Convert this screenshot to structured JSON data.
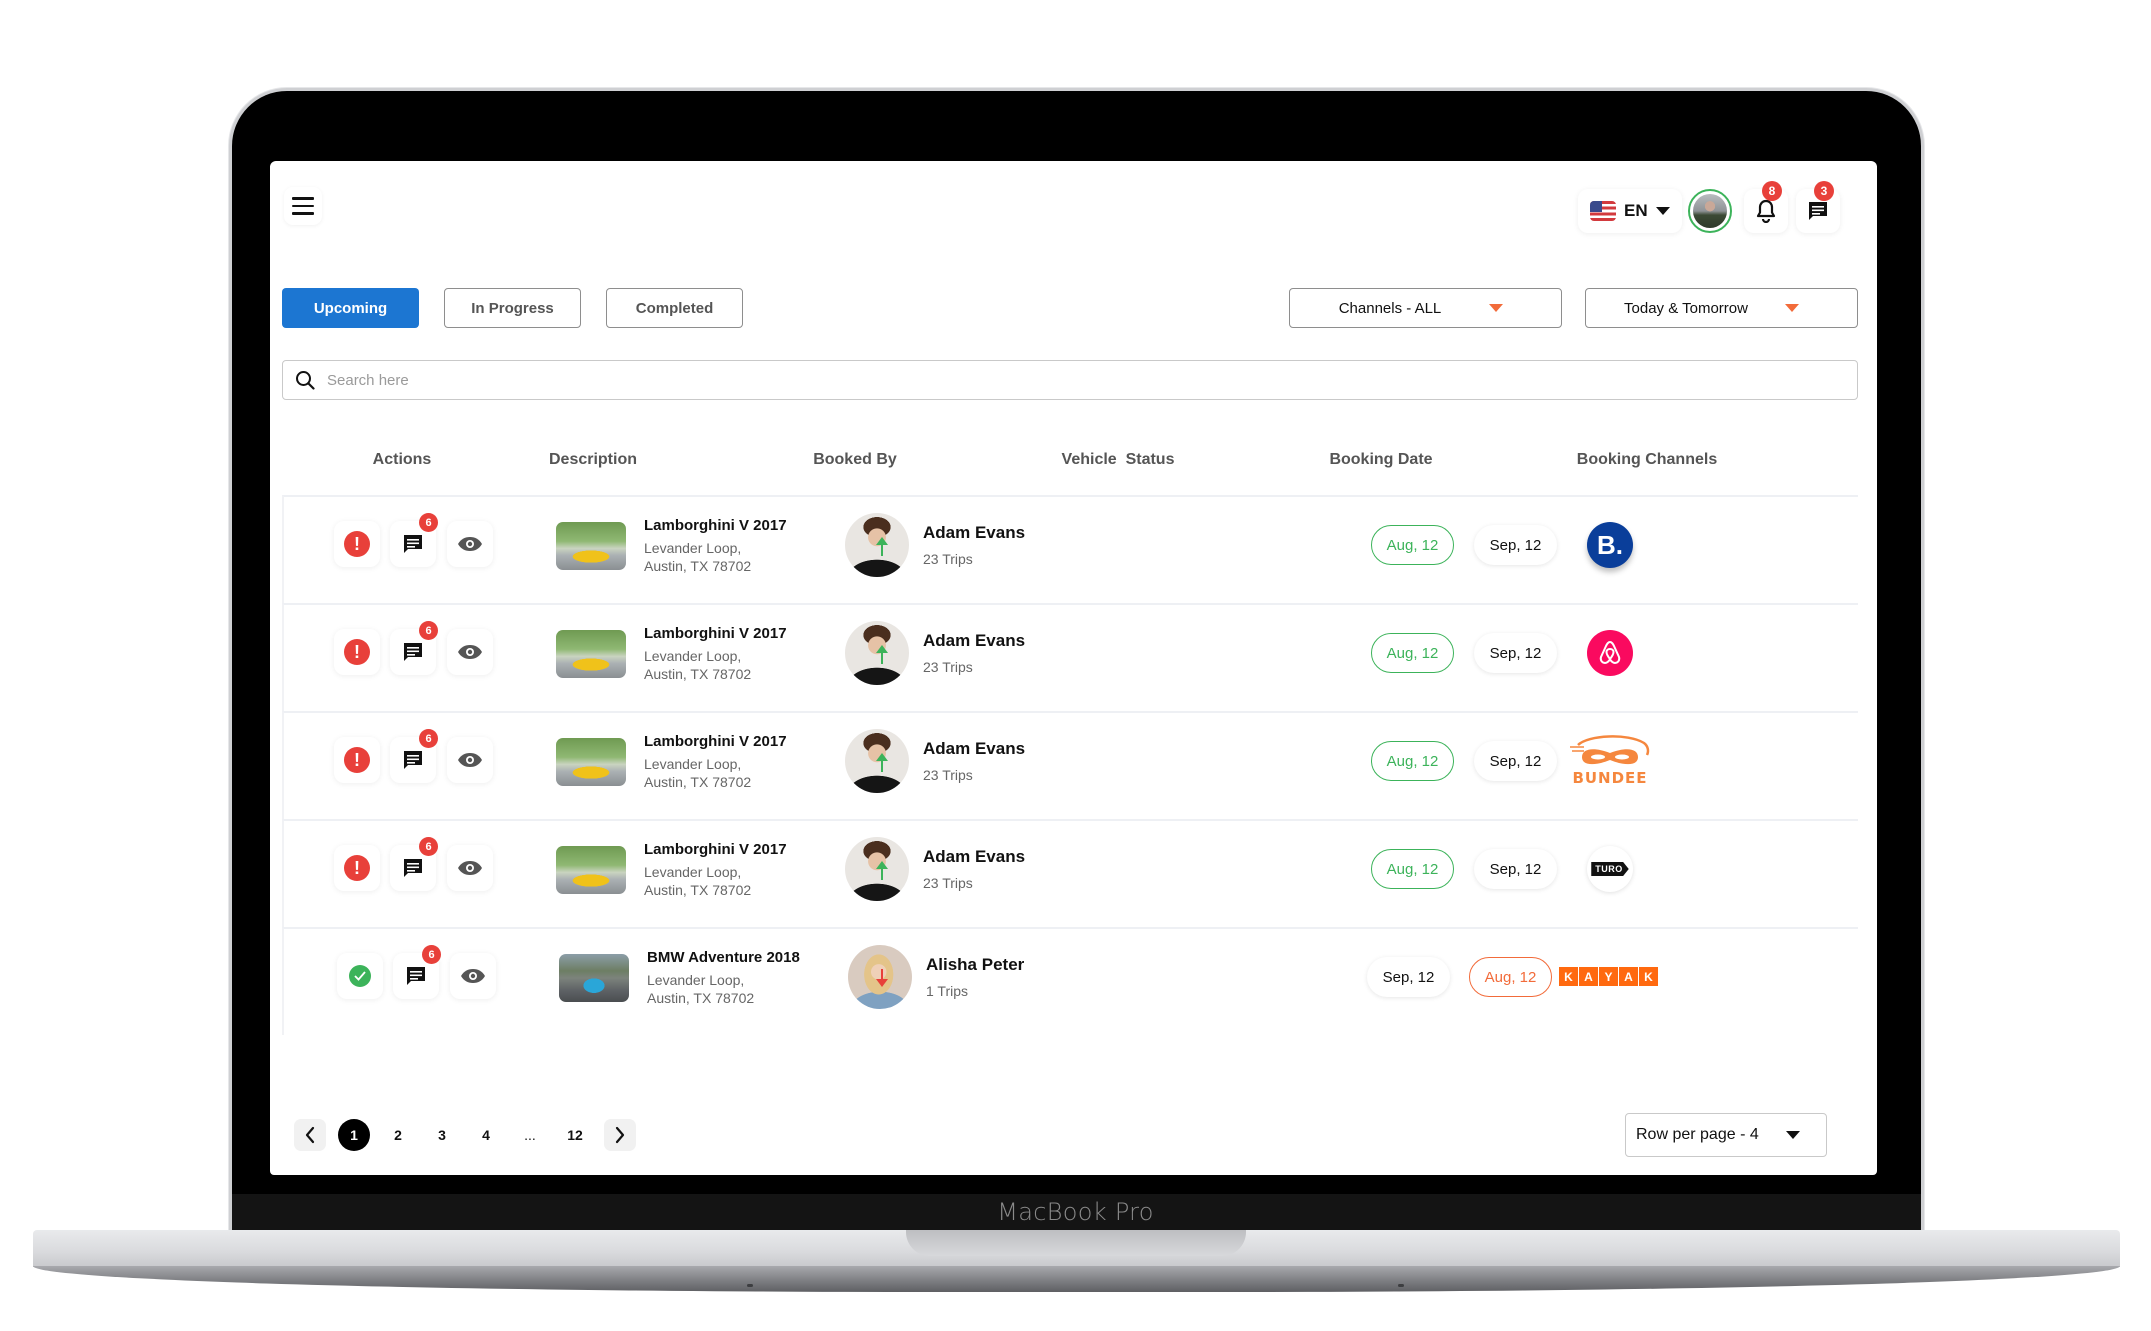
{
  "device": {
    "brand_label": "MacBook Pro"
  },
  "header": {
    "language": {
      "code": "EN",
      "flag": "us-flag-icon"
    },
    "notifications": {
      "count": "8",
      "icon": "bell-icon"
    },
    "messages": {
      "count": "3",
      "icon": "chat-icon"
    }
  },
  "tabs": [
    {
      "label": "Upcoming",
      "active": true
    },
    {
      "label": "In Progress",
      "active": false
    },
    {
      "label": "Completed",
      "active": false
    }
  ],
  "filters": {
    "channels": "Channels - ALL",
    "date_range": "Today & Tomorrow"
  },
  "search": {
    "placeholder": "Search here",
    "value": ""
  },
  "table": {
    "headers": [
      "Actions",
      "Description",
      "Booked By",
      "Vehicle  Status",
      "Booking Date",
      "Booking Channels"
    ],
    "rows": [
      {
        "status_icon": "alert-icon",
        "message_count": "6",
        "car_name": "Lamborghini V 2017",
        "address_line1": "Levander Loop,",
        "address_line2": "Austin, TX 78702",
        "booked_by": "Adam Evans",
        "trips": "23 Trips",
        "vehicle_status": "up",
        "date_start": "Aug, 12",
        "date_end": "Sep, 12",
        "channel": "Booking.com",
        "channel_mark": "B."
      },
      {
        "status_icon": "alert-icon",
        "message_count": "6",
        "car_name": "Lamborghini V 2017",
        "address_line1": "Levander Loop,",
        "address_line2": "Austin, TX 78702",
        "booked_by": "Adam Evans",
        "trips": "23 Trips",
        "vehicle_status": "up",
        "date_start": "Aug, 12",
        "date_end": "Sep, 12",
        "channel": "Airbnb"
      },
      {
        "status_icon": "alert-icon",
        "message_count": "6",
        "car_name": "Lamborghini V 2017",
        "address_line1": "Levander Loop,",
        "address_line2": "Austin, TX 78702",
        "booked_by": "Adam Evans",
        "trips": "23 Trips",
        "vehicle_status": "up",
        "date_start": "Aug, 12",
        "date_end": "Sep, 12",
        "channel": "Bundee",
        "channel_mark": "BUNDEE"
      },
      {
        "status_icon": "alert-icon",
        "message_count": "6",
        "car_name": "Lamborghini V 2017",
        "address_line1": "Levander Loop,",
        "address_line2": "Austin, TX 78702",
        "booked_by": "Adam Evans",
        "trips": "23 Trips",
        "vehicle_status": "up",
        "date_start": "Aug, 12",
        "date_end": "Sep, 12",
        "channel": "Turo",
        "channel_mark": "TURO"
      },
      {
        "status_icon": "check-icon",
        "message_count": "6",
        "car_name": "BMW Adventure 2018",
        "address_line1": "Levander Loop,",
        "address_line2": "Austin, TX 78702",
        "booked_by": "Alisha Peter",
        "trips": "1 Trips",
        "vehicle_status": "down",
        "date_start": "Sep, 12",
        "date_end": "Aug, 12",
        "channel": "Kayak",
        "channel_mark": [
          "K",
          "A",
          "Y",
          "A",
          "K"
        ]
      }
    ]
  },
  "pagination": {
    "pages": [
      "1",
      "2",
      "3",
      "4",
      "...",
      "12"
    ],
    "current": "1",
    "rows_per_page_label": "Row per page - 4"
  },
  "colors": {
    "primary": "#1c76d2",
    "success": "#3cb35a",
    "danger": "#e8403a",
    "accent_orange": "#f26b3a",
    "booking_blue": "#0a3e9a",
    "airbnb_pink": "#fa0a5f",
    "kayak_orange": "#ff690f",
    "bundee_orange": "#f5873e"
  }
}
